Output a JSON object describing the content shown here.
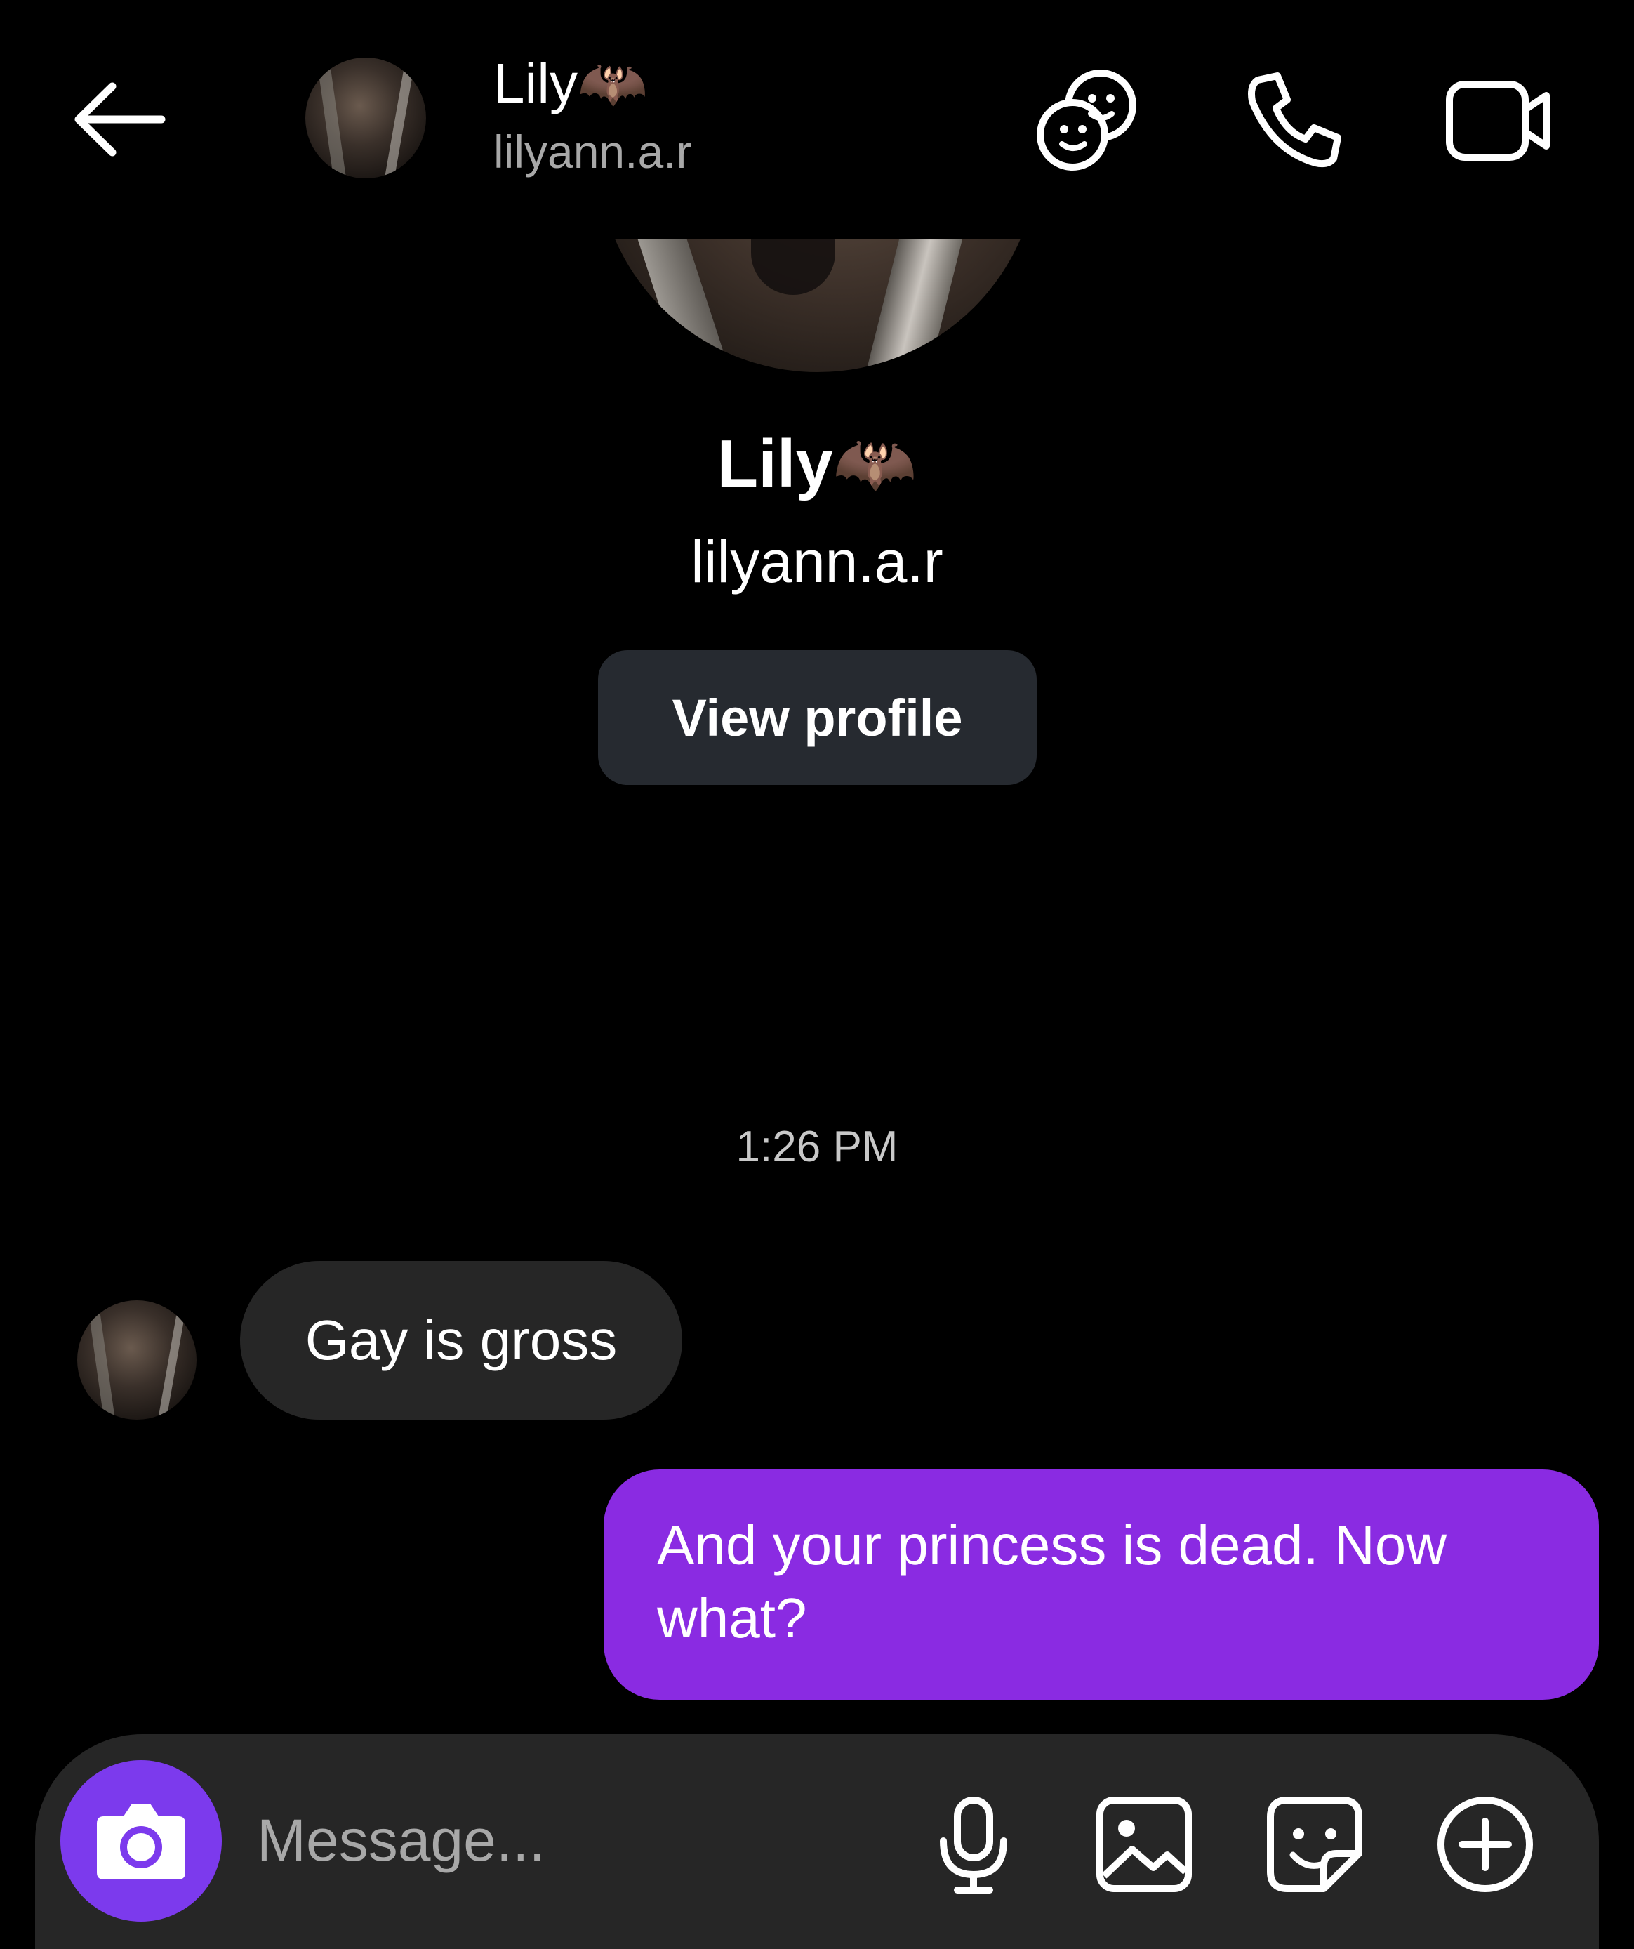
{
  "header": {
    "name": "Lily",
    "name_emoji": "🦇",
    "username": "lilyann.a.r"
  },
  "profile": {
    "name": "Lily",
    "name_emoji": "🦇",
    "username": "lilyann.a.r",
    "view_profile_label": "View profile"
  },
  "conversation": {
    "timestamp": "1:26 PM",
    "messages": [
      {
        "from": "them",
        "text": "Gay is gross"
      },
      {
        "from": "me",
        "text": "And your princess is dead. Now what?"
      }
    ]
  },
  "composer": {
    "placeholder": "Message..."
  },
  "colors": {
    "accent_purple": "#8a2be2",
    "camera_button": "#7c3aed",
    "incoming_bubble": "#262626",
    "view_profile_button": "#262a30"
  },
  "icons": [
    "back-arrow-icon",
    "stickers-faces-icon",
    "phone-icon",
    "video-camera-icon",
    "camera-icon",
    "microphone-icon",
    "gallery-icon",
    "sticker-icon",
    "plus-circle-icon"
  ]
}
